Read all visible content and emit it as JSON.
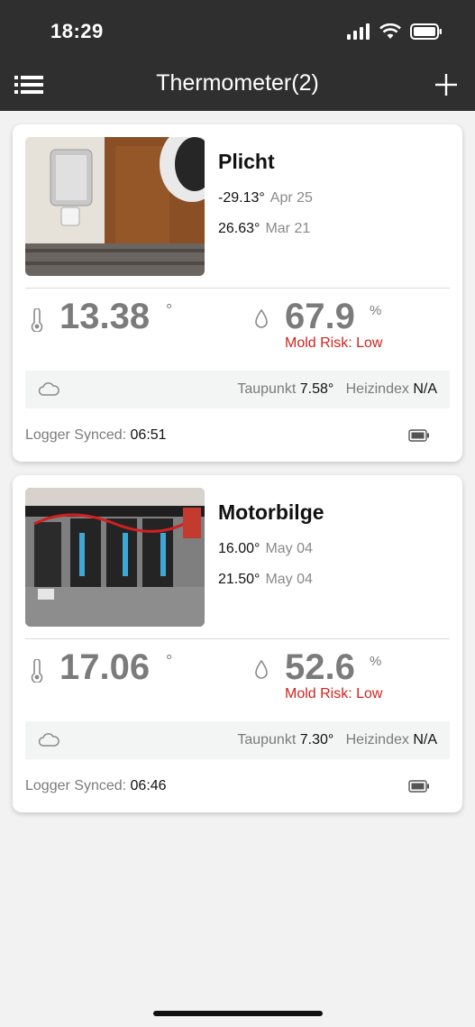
{
  "status_bar": {
    "time": "18:29"
  },
  "nav": {
    "title": "Thermometer(2)"
  },
  "devices": [
    {
      "name": "Plicht",
      "record_low": {
        "value": "-29.13°",
        "date": "Apr 25"
      },
      "record_high": {
        "value": "26.63°",
        "date": "Mar 21"
      },
      "temperature": "13.38",
      "temp_unit": "°",
      "humidity": "67.9",
      "humidity_unit": "%",
      "mold_risk": "Mold Risk: Low",
      "dewpoint_label": "Taupunkt",
      "dewpoint_value": "7.58°",
      "heatindex_label": "Heizindex",
      "heatindex_value": "N/A",
      "sync_label": "Logger Synced:",
      "sync_time": "06:51"
    },
    {
      "name": "Motorbilge",
      "record_low": {
        "value": "16.00°",
        "date": "May 04"
      },
      "record_high": {
        "value": "21.50°",
        "date": "May 04"
      },
      "temperature": "17.06",
      "temp_unit": "°",
      "humidity": "52.6",
      "humidity_unit": "%",
      "mold_risk": "Mold Risk: Low",
      "dewpoint_label": "Taupunkt",
      "dewpoint_value": "7.30°",
      "heatindex_label": "Heizindex",
      "heatindex_value": "N/A",
      "sync_label": "Logger Synced:",
      "sync_time": "06:46"
    }
  ],
  "colors": {
    "topbar": "#2f2f2f",
    "mold_risk": "#d0231e",
    "value_gray": "#7b7b7b"
  }
}
